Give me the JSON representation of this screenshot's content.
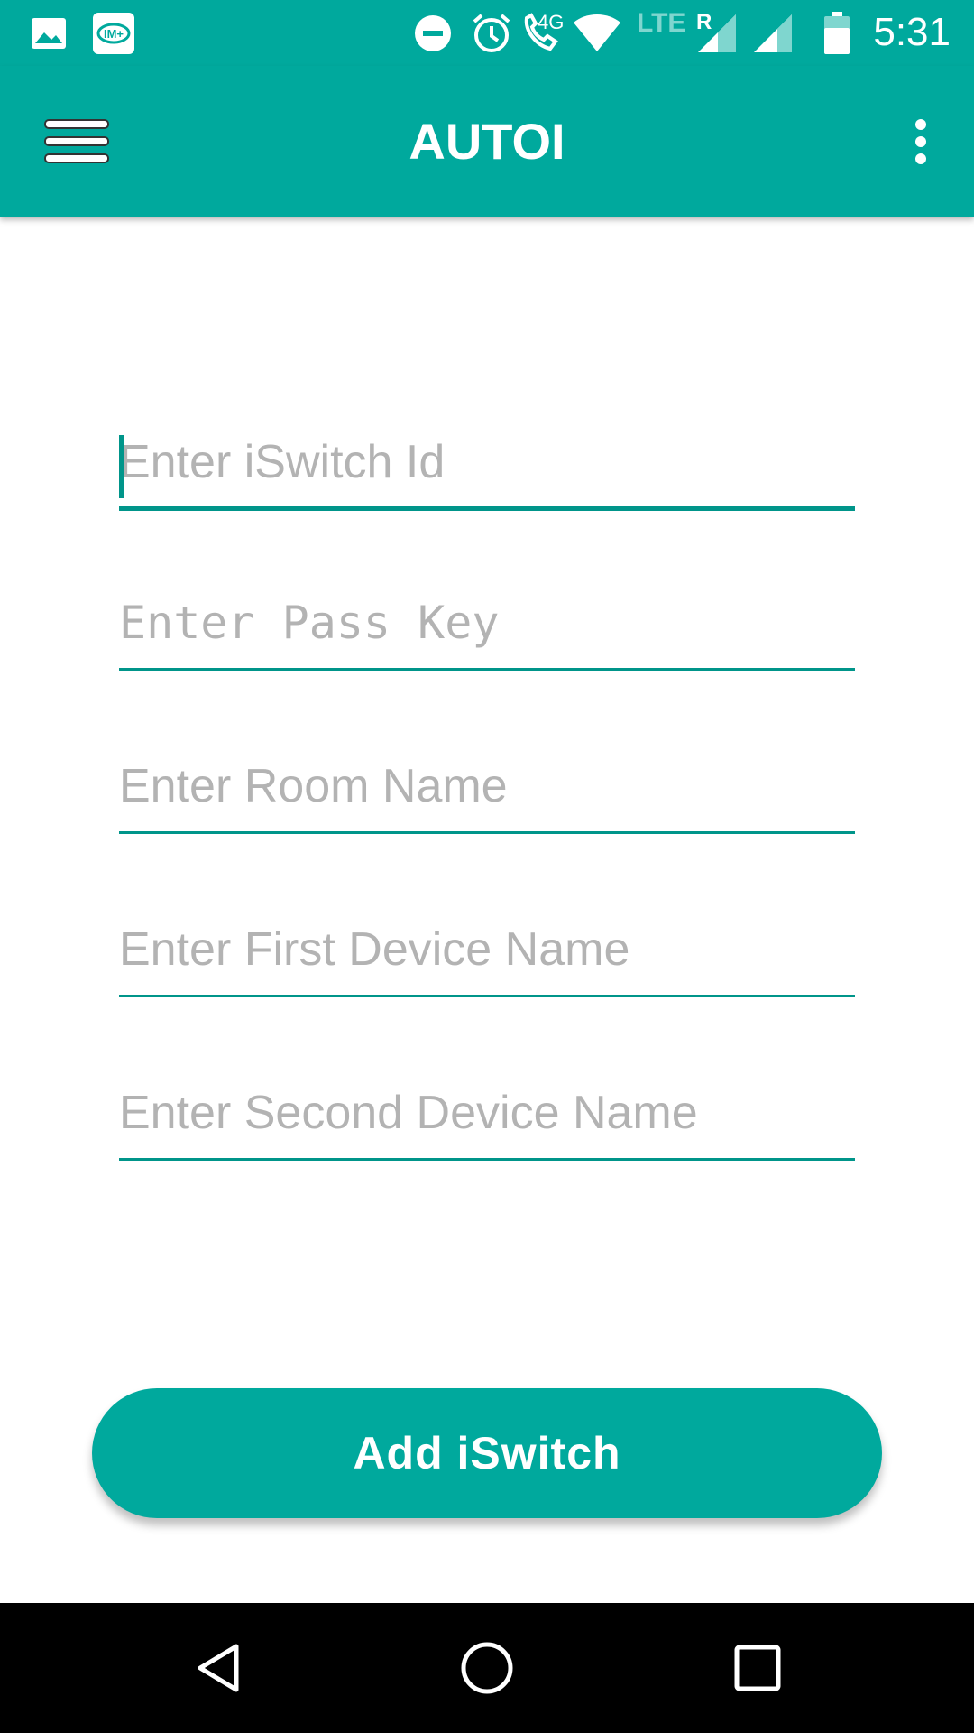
{
  "status_bar": {
    "time": "5:31",
    "network_label": "4G",
    "lte_label": "LTE",
    "roaming_label": "R",
    "icons": [
      "image-icon",
      "im-plus-icon",
      "do-not-disturb-icon",
      "alarm-icon",
      "wifi-call-icon",
      "wifi-icon",
      "signal-icon",
      "signal-icon-2",
      "battery-icon"
    ]
  },
  "app_bar": {
    "title": "AUTOI",
    "menu_icon": "hamburger-menu-icon",
    "more_icon": "more-vert-icon"
  },
  "form": {
    "iswitch_id": {
      "placeholder": "Enter iSwitch Id",
      "value": ""
    },
    "pass_key": {
      "placeholder": "Enter Pass Key",
      "value": ""
    },
    "room_name": {
      "placeholder": "Enter Room Name",
      "value": ""
    },
    "first_device": {
      "placeholder": "Enter First Device Name",
      "value": ""
    },
    "second_device": {
      "placeholder": "Enter Second Device Name",
      "value": ""
    }
  },
  "actions": {
    "add_label": "Add iSwitch"
  },
  "nav_bar": {
    "icons": [
      "back-icon",
      "home-icon",
      "recents-icon"
    ]
  },
  "colors": {
    "primary": "#00a99d",
    "underline": "#00958a",
    "placeholder": "#b3b3b3"
  }
}
